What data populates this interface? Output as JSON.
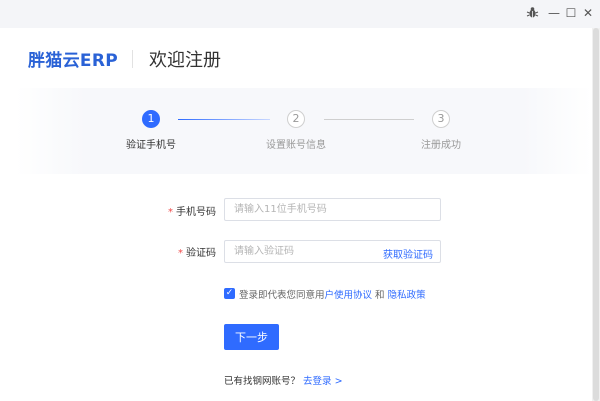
{
  "titlebar": {
    "bug_icon": "bug-icon",
    "minimize_glyph": "—",
    "maximize_glyph": "☐",
    "close_glyph": "✕"
  },
  "header": {
    "brand": "胖猫云ERP",
    "title": "欢迎注册",
    "brand_color": "#2a62d6"
  },
  "steps": [
    {
      "number": "1",
      "label": "验证手机号",
      "state": "active"
    },
    {
      "number": "2",
      "label": "设置账号信息",
      "state": "pending"
    },
    {
      "number": "3",
      "label": "注册成功",
      "state": "pending"
    }
  ],
  "form": {
    "required_mark": "*",
    "phone": {
      "label": "手机号码",
      "placeholder": "请输入11位手机号码",
      "value": ""
    },
    "code": {
      "label": "验证码",
      "placeholder": "请输入验证码",
      "value": "",
      "get_code_label": "获取验证码"
    },
    "agreement": {
      "checked": true,
      "prefix": "登录即代表您同意用",
      "user_agreement": "户使用协议",
      "conjunction": " 和 ",
      "privacy": "隐私政策"
    },
    "next_button": "下一步"
  },
  "footer": {
    "prompt": "已有找钢网账号？",
    "login_link": "去登录 >"
  },
  "colors": {
    "accent": "#2f6bff",
    "required": "#f04a4a"
  }
}
